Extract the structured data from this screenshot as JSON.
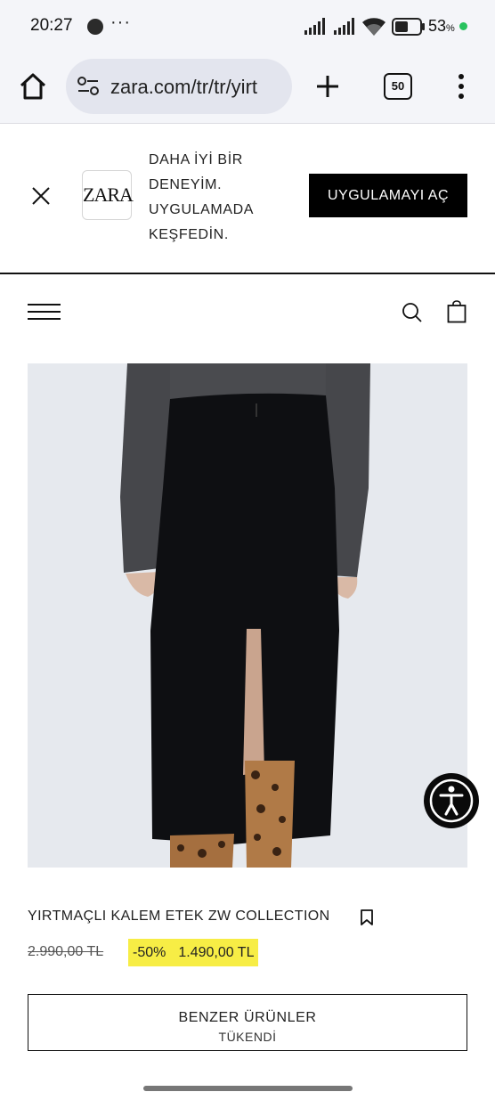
{
  "status_bar": {
    "time": "20:27",
    "more": "···",
    "battery_percent": "53",
    "battery_unit": "%",
    "battery_level": 0.53,
    "icons": [
      "notification-dot-icon",
      "signal-icon",
      "signal-icon",
      "wifi-icon",
      "battery-icon",
      "charging-dot-icon"
    ]
  },
  "browser": {
    "url": "zara.com/tr/tr/yirt",
    "tab_count": "50",
    "icons": [
      "home-icon",
      "site-settings-icon",
      "new-tab-icon",
      "tabs-icon",
      "more-vert-icon"
    ]
  },
  "app_banner": {
    "text_lines": [
      "DAHA İYİ BİR",
      "DENEYİM.",
      "UYGULAMADA",
      "KEŞFEDİN."
    ],
    "logo_text": "ZARA",
    "open_app_label": "UYGULAMAYI AÇ"
  },
  "product": {
    "title": "YIRTMAÇLI KALEM ETEK ZW COLLECTION",
    "old_price": "2.990,00 TL",
    "discount": "-50%",
    "new_price": "1.490,00 TL",
    "similar_label_1": "BENZER ÜRÜNLER",
    "similar_label_2": "TÜKENDİ"
  },
  "colors": {
    "browser_bg": "#f4f5f9",
    "url_pill": "#e3e5ee",
    "sale_highlight": "#f7ed45",
    "battery_dot": "#28c25e",
    "black": "#000000"
  }
}
